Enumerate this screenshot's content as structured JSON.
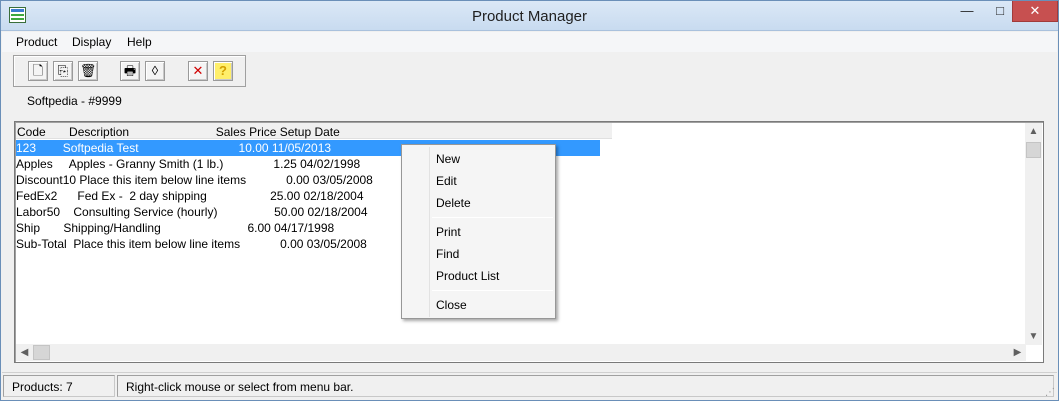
{
  "window": {
    "title": "Product Manager",
    "min_glyph": "—",
    "max_glyph": "□",
    "close_glyph": "✕"
  },
  "menu": {
    "items": [
      "Product",
      "Display",
      "Help"
    ]
  },
  "toolbar": {
    "new": "🗋",
    "copy": "⎘",
    "delete": "🗑",
    "print": "🖶",
    "find": "◊",
    "cancel": "✕",
    "help": "?"
  },
  "company": "Softpedia - #9999",
  "list": {
    "header": "Code       Description                          Sales Price Setup Date",
    "rows": [
      "123        Softpedia Test                              10.00 11/05/2013",
      "Apples     Apples - Granny Smith (1 lb.)               1.25 04/02/1998",
      "Discount10 Place this item below line items            0.00 03/05/2008",
      "FedEx2      Fed Ex -  2 day shipping                   25.00 02/18/2004",
      "Labor50    Consulting Service (hourly)                 50.00 02/18/2004",
      "Ship       Shipping/Handling                          6.00 04/17/1998",
      "Sub-Total  Place this item below line items            0.00 03/05/2008"
    ]
  },
  "context_menu": {
    "new": "New",
    "edit": "Edit",
    "delete": "Delete",
    "print": "Print",
    "find": "Find",
    "product_list": "Product List",
    "close": "Close"
  },
  "status": {
    "count": "Products: 7",
    "hint": "Right-click mouse or select from menu bar."
  },
  "icons": {
    "scroll_up": "▲",
    "scroll_down": "▼",
    "scroll_left": "◀",
    "scroll_right": "▶",
    "grip": "⋰"
  },
  "colors": {
    "selection": "#3399ff",
    "close_button": "#c75050",
    "cancel_icon": "#d00000",
    "help_icon": "#d4a000"
  }
}
